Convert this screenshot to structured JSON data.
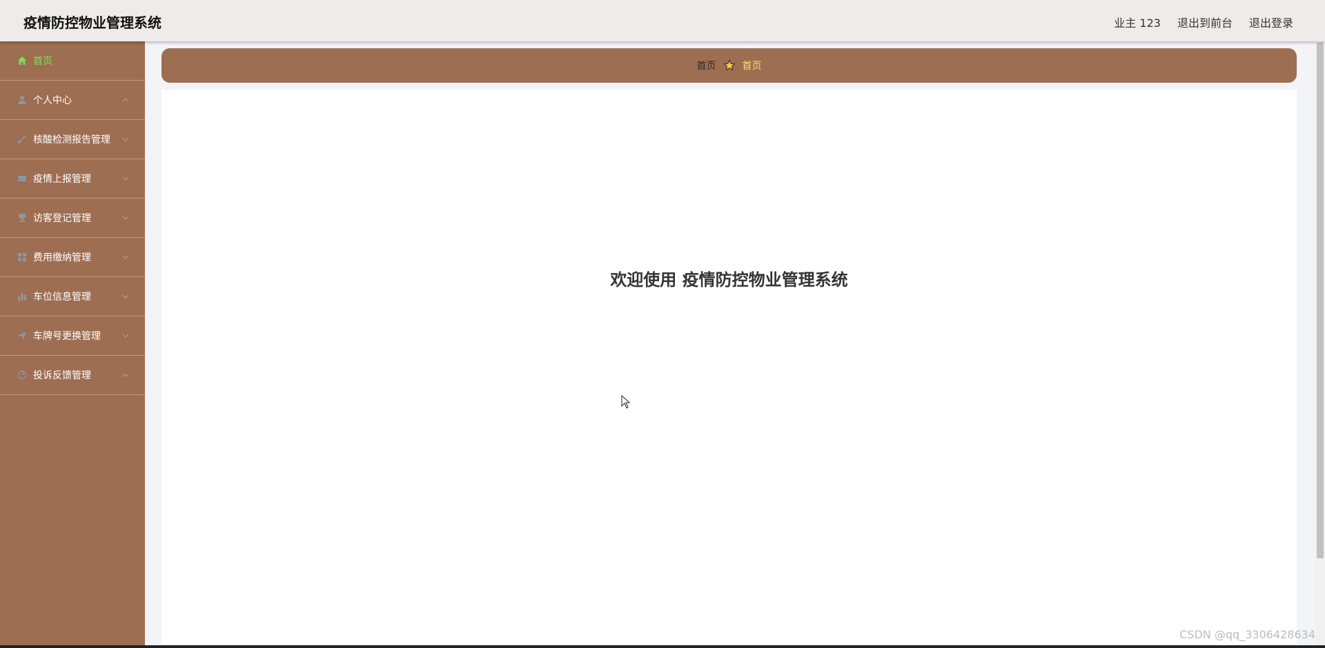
{
  "header": {
    "title": "疫情防控物业管理系统",
    "user": "业主 123",
    "back_front": "退出到前台",
    "logout": "退出登录"
  },
  "sidebar": {
    "items": [
      {
        "label": "首页",
        "icon": "home-icon"
      },
      {
        "label": "个人中心",
        "icon": "user-icon"
      },
      {
        "label": "核酸检测报告管理",
        "icon": "swab-icon"
      },
      {
        "label": "疫情上报管理",
        "icon": "ticket-icon"
      },
      {
        "label": "访客登记管理",
        "icon": "stamp-icon"
      },
      {
        "label": "费用缴纳管理",
        "icon": "grid-icon"
      },
      {
        "label": "车位信息管理",
        "icon": "bar-chart-icon"
      },
      {
        "label": "车牌号更换管理",
        "icon": "send-icon"
      },
      {
        "label": "投诉反馈管理",
        "icon": "dashboard-icon"
      }
    ]
  },
  "breadcrumb": {
    "root": "首页",
    "current": "首页"
  },
  "main": {
    "welcome": "欢迎使用 疫情防控物业管理系统"
  },
  "watermark": "CSDN @qq_3306428634",
  "colors": {
    "sidebar_bg": "#9e6e52",
    "active_text": "#7fdc5a",
    "breadcrumb_current": "#f2e36b",
    "header_bg": "#f0ebeb"
  }
}
